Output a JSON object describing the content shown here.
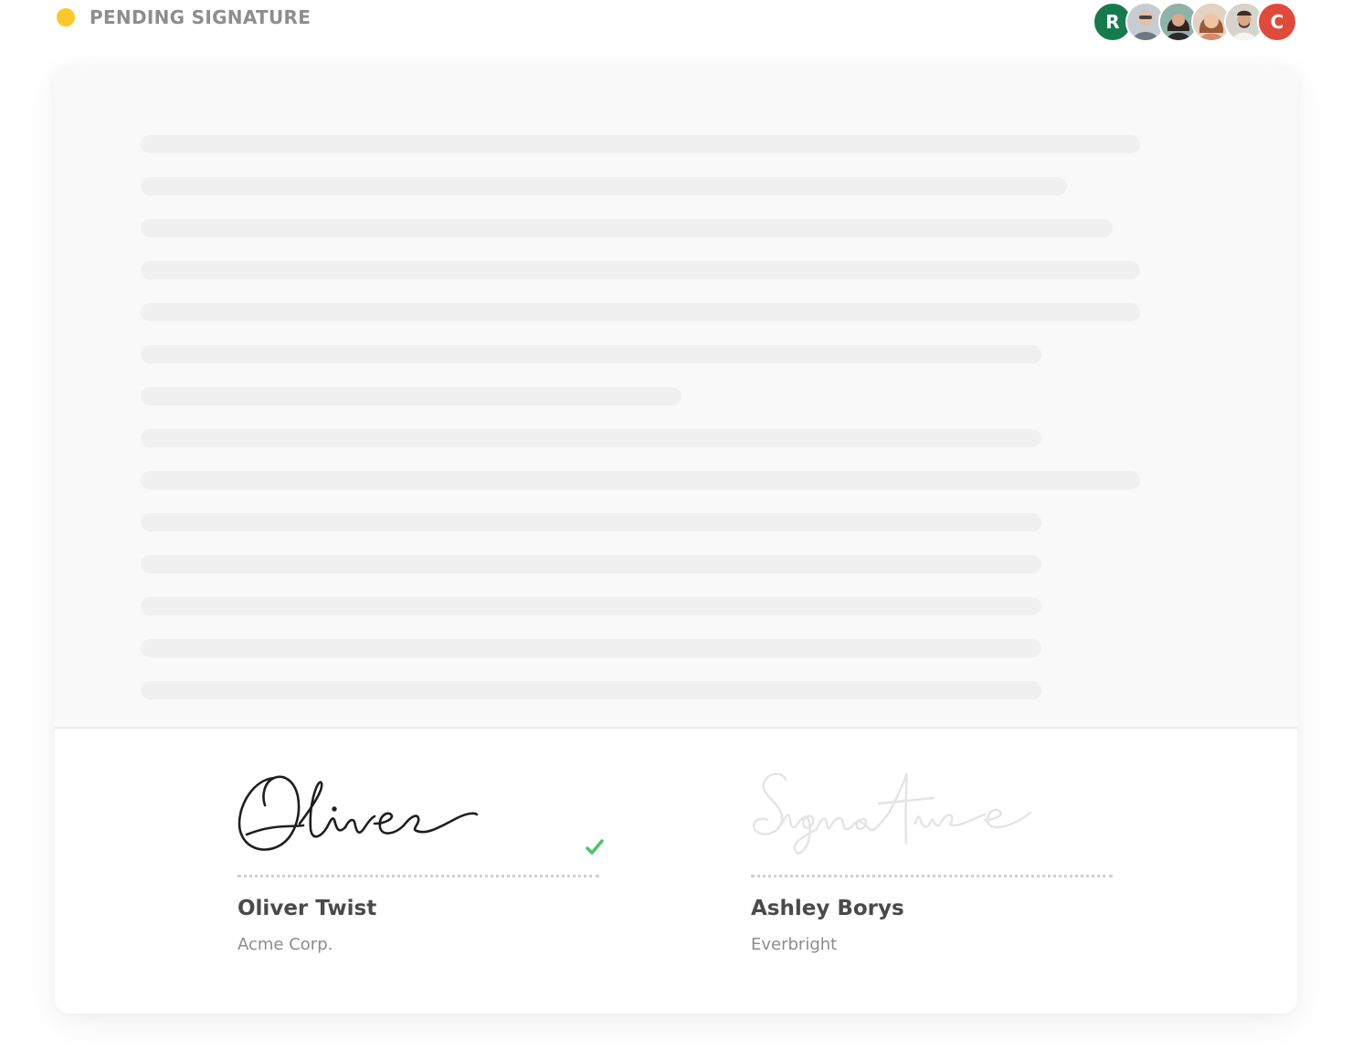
{
  "status": {
    "label": "PENDING SIGNATURE",
    "dot_color": "#fdc629"
  },
  "collaborators": [
    {
      "type": "initial",
      "text": "R",
      "color": "#177a4e"
    },
    {
      "type": "photo",
      "icon": "person-avatar-icon"
    },
    {
      "type": "photo",
      "icon": "person-avatar-icon"
    },
    {
      "type": "photo",
      "icon": "person-avatar-icon"
    },
    {
      "type": "photo",
      "icon": "person-avatar-icon"
    },
    {
      "type": "initial",
      "text": "C",
      "color": "#e04a3b"
    }
  ],
  "document": {
    "placeholder_color": "#f0f0f0"
  },
  "signatures": [
    {
      "name": "Oliver Twist",
      "company": "Acme Corp.",
      "signature_text": "Oliver",
      "signed": true,
      "status_icon": "check-icon",
      "check_color": "#4cc46a"
    },
    {
      "name": "Ashley Borys",
      "company": "Everbright",
      "signature_text": "Signature",
      "signed": false
    }
  ]
}
